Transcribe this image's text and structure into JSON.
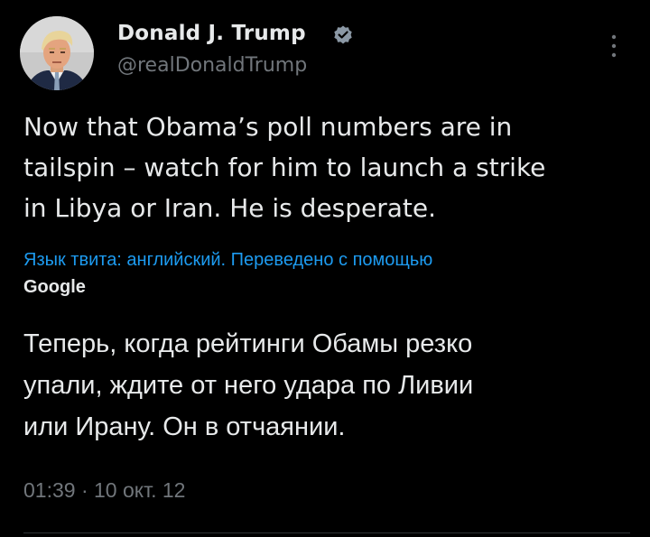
{
  "author": {
    "name": "Donald J. Trump",
    "handle": "@realDonaldTrump",
    "verified_icon": "verified-badge-icon",
    "avatar": "profile-photo"
  },
  "tweet": {
    "text": "Now that Obama’s poll numbers are in\ntailspin – watch for him to launch a strike\nin Libya or Iran.  He is desperate.",
    "translation_note": "Язык твита: английский. Переведено с помощью",
    "translation_provider": "Google",
    "translated_text": "Теперь, когда рейтинги Обамы резко\nупали, ждите от него удара по Ливии\nили Ирану. Он в отчаянии.",
    "timestamp": "01:39 · 10 окт. 12"
  },
  "menu": {
    "icon": "more-options-icon"
  },
  "colors": {
    "background": "#000000",
    "text": "#e7e9ea",
    "secondary": "#71767b",
    "link": "#1d9bf0",
    "divider": "#2f3336"
  }
}
